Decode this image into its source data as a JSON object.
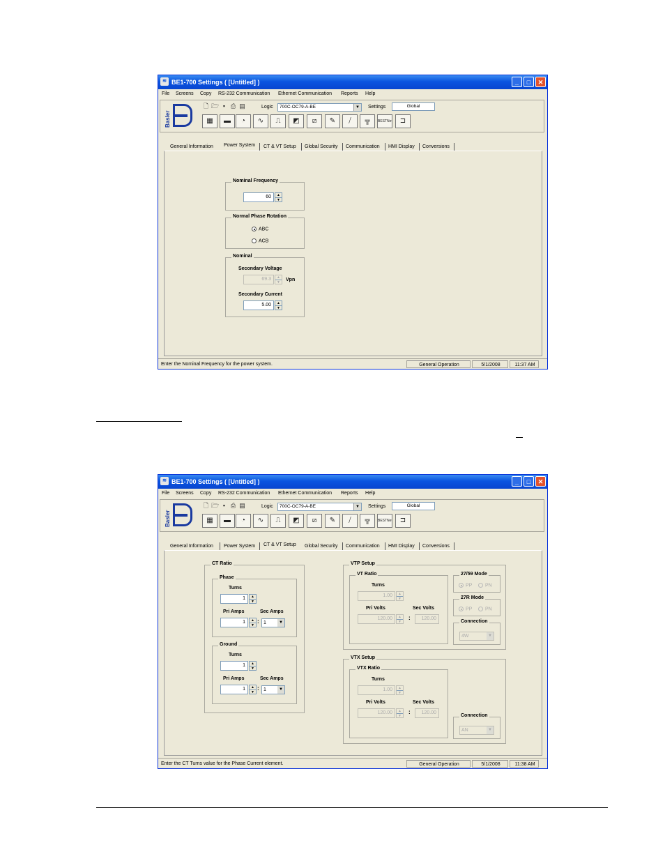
{
  "window1": {
    "title": "BE1-700 Settings   ( [Untitled] )",
    "menu": [
      "File",
      "Screens",
      "Copy",
      "RS-232 Communication",
      "Ethernet Communication",
      "Reports",
      "Help"
    ],
    "logic_label": "Logic",
    "logic_value": "700C-OC79-A-BE",
    "settings_label": "Settings",
    "settings_value": "Global",
    "tabs": [
      "General Information",
      "Power System",
      "CT & VT Setup",
      "Global Security",
      "Communication",
      "HMI Display",
      "Conversions"
    ],
    "active_tab": "Power System",
    "nominal_frequency": {
      "title": "Nominal Frequency",
      "value": "60"
    },
    "phase_rotation": {
      "title": "Normal Phase Rotation",
      "options": [
        "ABC",
        "ACB"
      ],
      "selected": "ABC"
    },
    "nominal": {
      "title": "Nominal",
      "secondary_voltage_label": "Secondary Voltage",
      "secondary_voltage_value": "69.3",
      "voltage_unit": "Vpn",
      "secondary_current_label": "Secondary Current",
      "secondary_current_value": "5.00"
    },
    "status": {
      "message": "Enter the Nominal Frequency for the power system.",
      "mode": "General Operation",
      "date": "5/1/2008",
      "time": "11:37 AM"
    }
  },
  "window2": {
    "title": "BE1-700 Settings   ( [Untitled] )",
    "menu": [
      "File",
      "Screens",
      "Copy",
      "RS-232 Communication",
      "Ethernet Communication",
      "Reports",
      "Help"
    ],
    "logic_label": "Logic",
    "logic_value": "700C-OC79-A-BE",
    "settings_label": "Settings",
    "settings_value": "Global",
    "tabs": [
      "General Information",
      "Power System",
      "CT & VT Setup",
      "Global Security",
      "Communication",
      "HMI Display",
      "Conversions"
    ],
    "active_tab": "CT & VT Setup",
    "ct_ratio": {
      "title": "CT Ratio",
      "phase": {
        "title": "Phase",
        "turns_label": "Turns",
        "turns": "1",
        "pri_label": "Pri Amps",
        "pri": "1",
        "sec_label": "Sec Amps",
        "sec": "1"
      },
      "ground": {
        "title": "Ground",
        "turns_label": "Turns",
        "turns": "1",
        "pri_label": "Pri Amps",
        "pri": "1",
        "sec_label": "Sec Amps",
        "sec": "1"
      }
    },
    "vtp_setup": {
      "title": "VTP Setup",
      "ratio_title": "VT Ratio",
      "turns_label": "Turns",
      "turns": "1.00",
      "pri_label": "Pri Volts",
      "pri": "120.00",
      "sec_label": "Sec Volts",
      "sec": "120.00",
      "mode_2759": {
        "title": "27/59 Mode",
        "options": [
          "PP",
          "PN"
        ]
      },
      "mode_27r": {
        "title": "27R Mode",
        "options": [
          "PP",
          "PN"
        ]
      },
      "connection_label": "Connection",
      "connection": "4W"
    },
    "vtx_setup": {
      "title": "VTX Setup",
      "ratio_title": "VTX Ratio",
      "turns_label": "Turns",
      "turns": "1.00",
      "pri_label": "Pri Volts",
      "pri": "120.00",
      "sec_label": "Sec Volts",
      "sec": "120.00",
      "connection_label": "Connection",
      "connection": "AN"
    },
    "status": {
      "message": "Enter the CT Turns value for the Phase Current element.",
      "mode": "General Operation",
      "date": "5/1/2008",
      "time": "11:38 AM"
    }
  },
  "colors": {
    "titlebar": "#0a54e0",
    "window_bg": "#ece9d8",
    "close_button": "#e4532c",
    "logo": "#1a3aa0"
  },
  "logo_text": "Basler"
}
